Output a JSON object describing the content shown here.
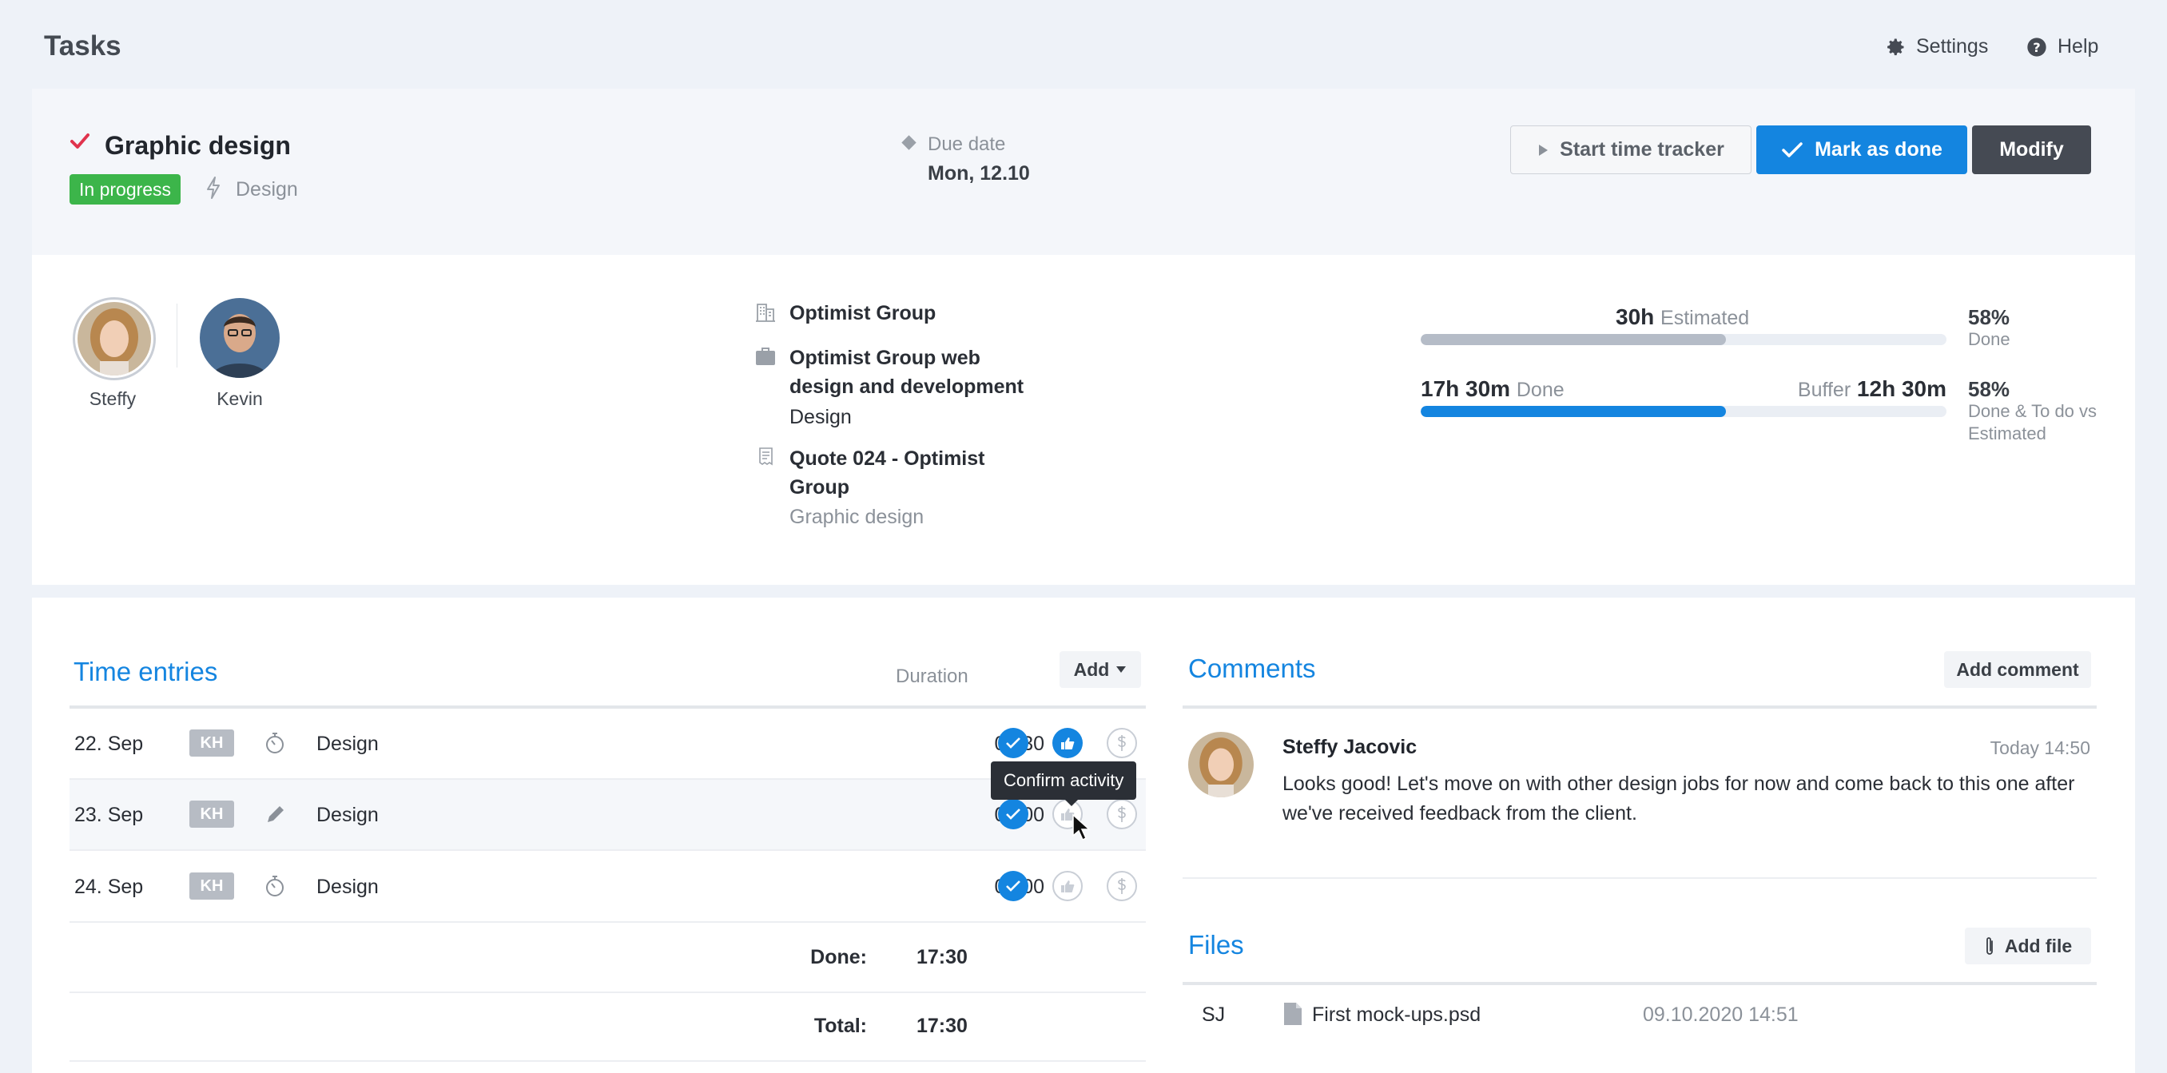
{
  "header": {
    "title": "Tasks",
    "settings_label": "Settings",
    "help_label": "Help"
  },
  "task": {
    "name": "Graphic design",
    "status": "In progress",
    "category": "Design",
    "due_label": "Due date",
    "due_value": "Mon, 12.10",
    "actions": {
      "start_tracker": "Start time tracker",
      "mark_done": "Mark as done",
      "modify": "Modify"
    }
  },
  "assignees": [
    {
      "name": "Steffy"
    },
    {
      "name": "Kevin"
    }
  ],
  "project": {
    "company": "Optimist Group",
    "project_name": "Optimist Group web design and development",
    "project_type": "Design",
    "quote": "Quote 024 - Optimist Group",
    "quote_item": "Graphic design"
  },
  "progress": {
    "estimated_value": "30h",
    "estimated_label": "Estimated",
    "estimated_fraction": 0.58,
    "done_pct": "58%",
    "done_pct_label": "Done",
    "done_value": "17h 30m",
    "done_label": "Done",
    "buffer_label": "Buffer",
    "buffer_value": "12h 30m",
    "done_fraction": 0.58,
    "todo_pct": "58%",
    "todo_pct_label": "Done & To do vs Estimated"
  },
  "time_entries": {
    "title": "Time entries",
    "duration_header": "Duration",
    "add_label": "Add",
    "rows": [
      {
        "date": "22. Sep",
        "user": "KH",
        "type_icon": "stopwatch-icon",
        "description": "Design",
        "duration": "04:30",
        "confirmed": true
      },
      {
        "date": "23. Sep",
        "user": "KH",
        "type_icon": "pencil-icon",
        "description": "Design",
        "duration": "06:00",
        "confirmed": false
      },
      {
        "date": "24. Sep",
        "user": "KH",
        "type_icon": "stopwatch-icon",
        "description": "Design",
        "duration": "07:00",
        "confirmed": false
      }
    ],
    "done_label": "Done:",
    "done_value": "17:30",
    "total_label": "Total:",
    "total_value": "17:30",
    "tooltip": "Confirm activity"
  },
  "comments": {
    "title": "Comments",
    "add_label": "Add comment",
    "items": [
      {
        "author": "Steffy Jacovic",
        "time": "Today 14:50",
        "text": "Looks good! Let's move on with other design jobs for now and come back to this one after we've received feedback from the client."
      }
    ]
  },
  "files": {
    "title": "Files",
    "add_label": "Add file",
    "items": [
      {
        "user": "SJ",
        "name": "First mock-ups.psd",
        "date": "09.10.2020 14:51"
      }
    ]
  },
  "colors": {
    "accent": "#1485e0",
    "status_green": "#3cb54a",
    "dark_button": "#454a53",
    "check_red": "#e0334d"
  }
}
